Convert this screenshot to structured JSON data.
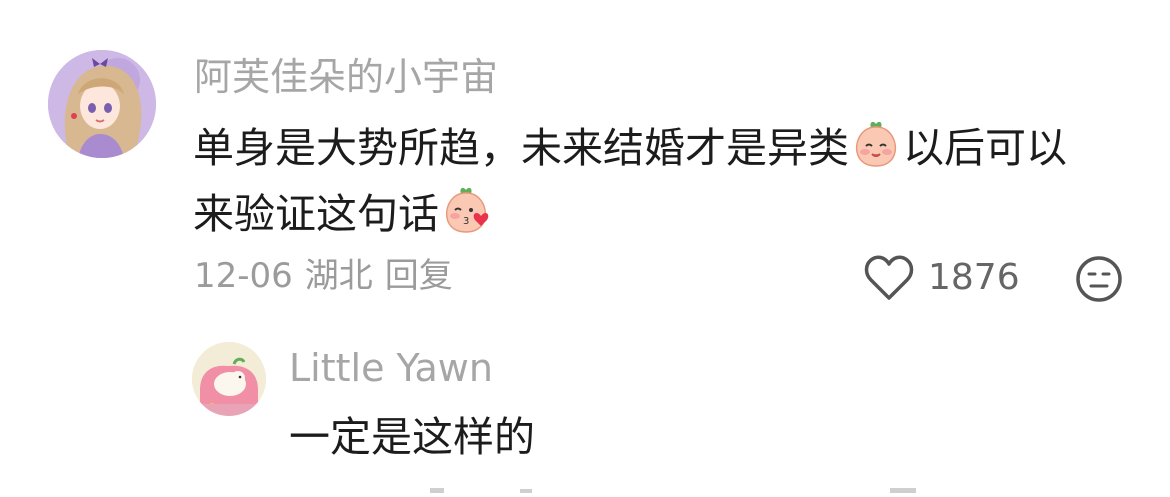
{
  "comment": {
    "username": "阿芙佳朵的小宇宙",
    "text_line1_part1": "单身是大势所趋，未来结婚才是异类",
    "text_line1_part2": "以后可以",
    "text_line2": "来验证这句话",
    "emoji1": "smiling-peach-emoji",
    "emoji2": "kissing-peach-emoji",
    "date": "12-06",
    "location": "湖北",
    "reply_label": "回复",
    "like_count": "1876"
  },
  "reply": {
    "username": "Little Yawn",
    "text": "一定是这样的"
  },
  "icons": {
    "like": "heart-icon",
    "dislike": "neutral-face-icon"
  },
  "colors": {
    "username": "#a6a6a6",
    "meta": "#9b9b9b",
    "text": "#1c1c1c",
    "avatar1_bg": "#c9b2e3"
  }
}
